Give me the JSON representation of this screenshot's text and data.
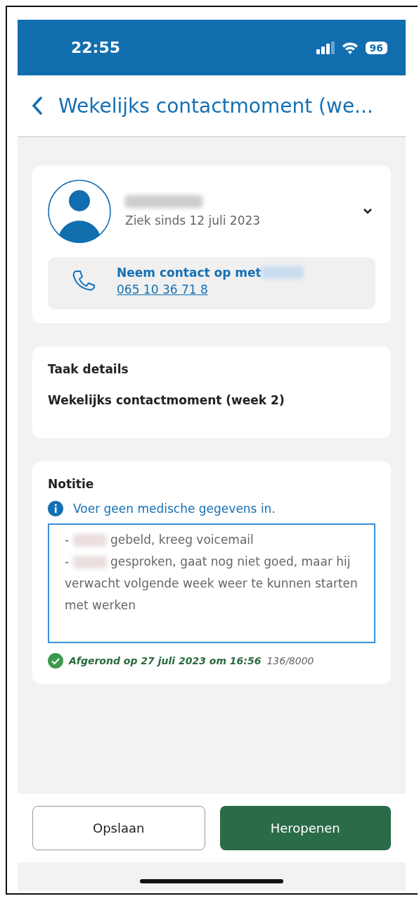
{
  "status_bar": {
    "time": "22:55",
    "battery": "96"
  },
  "header": {
    "title": "Wekelijks contactmoment (we..."
  },
  "employee": {
    "subtitle": "Ziek sinds 12 juli 2023",
    "expanded": false,
    "contact_label": "Neem contact op met",
    "phone": "065 10 36 71 8"
  },
  "task": {
    "heading": "Taak details",
    "description": "Wekelijks contactmoment (week 2)"
  },
  "note": {
    "heading": "Notitie",
    "warning": "Voer geen medische gegevens in.",
    "lines": [
      {
        "prefix": "-",
        "text": "gebeld, kreeg voicemail"
      },
      {
        "prefix": "-",
        "text": "gesproken, gaat nog niet goed, maar hij verwacht volgende week weer te kunnen starten met werken"
      }
    ],
    "completed": true,
    "status": "Afgerond op 27 juli 2023 om 16:56",
    "counter": "136/8000"
  },
  "buttons": [
    {
      "label": "Opslaan",
      "kind": "secondary"
    },
    {
      "label": "Heropenen",
      "kind": "primary"
    }
  ]
}
